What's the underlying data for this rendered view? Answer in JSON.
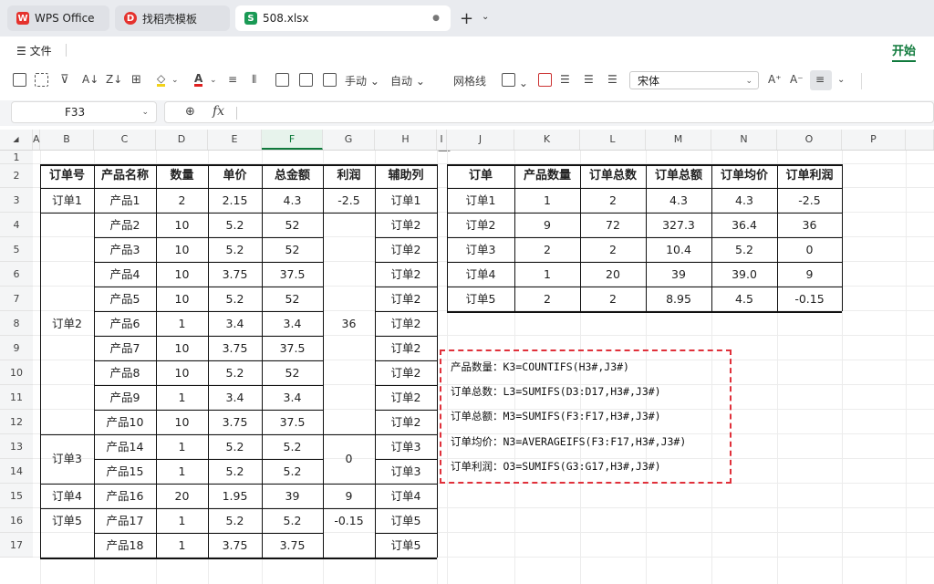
{
  "tabs": [
    {
      "label": "WPS Office",
      "icon": "wps-logo-icon"
    },
    {
      "label": "找稻壳模板",
      "icon": "docer-icon"
    },
    {
      "label": "508.xlsx",
      "icon": "spreadsheet-icon",
      "active": true
    }
  ],
  "menu": {
    "file": "文件",
    "start": "开始"
  },
  "toolbar": {
    "manual": "手动",
    "auto": "自动",
    "gridlines": "网格线",
    "font": "宋体"
  },
  "formula": {
    "cell_ref": "F33",
    "fx": "fx",
    "content": ""
  },
  "columns": [
    "A",
    "B",
    "C",
    "D",
    "E",
    "F",
    "G",
    "H",
    "I",
    "J",
    "K",
    "L",
    "M",
    "N",
    "O",
    "P"
  ],
  "rows": [
    "1",
    "2",
    "3",
    "4",
    "5",
    "6",
    "7",
    "8",
    "9",
    "10",
    "11",
    "12",
    "13",
    "14",
    "15",
    "16",
    "17"
  ],
  "left_table": {
    "headers": [
      "订单号",
      "产品名称",
      "数量",
      "单价",
      "总金额",
      "利润",
      "辅助列"
    ],
    "rows": [
      {
        "order": "订单1",
        "product": "产品1",
        "qty": "2",
        "price": "2.15",
        "total": "4.3",
        "profit": "-2.5",
        "helper": "订单1"
      },
      {
        "order": "",
        "product": "产品2",
        "qty": "10",
        "price": "5.2",
        "total": "52",
        "profit": "",
        "helper": "订单2"
      },
      {
        "order": "",
        "product": "产品3",
        "qty": "10",
        "price": "5.2",
        "total": "52",
        "profit": "",
        "helper": "订单2"
      },
      {
        "order": "",
        "product": "产品4",
        "qty": "10",
        "price": "3.75",
        "total": "37.5",
        "profit": "",
        "helper": "订单2"
      },
      {
        "order": "",
        "product": "产品5",
        "qty": "10",
        "price": "5.2",
        "total": "52",
        "profit": "",
        "helper": "订单2"
      },
      {
        "order": "订单2",
        "product": "产品6",
        "qty": "1",
        "price": "3.4",
        "total": "3.4",
        "profit": "36",
        "helper": "订单2"
      },
      {
        "order": "",
        "product": "产品7",
        "qty": "10",
        "price": "3.75",
        "total": "37.5",
        "profit": "",
        "helper": "订单2"
      },
      {
        "order": "",
        "product": "产品8",
        "qty": "10",
        "price": "5.2",
        "total": "52",
        "profit": "",
        "helper": "订单2"
      },
      {
        "order": "",
        "product": "产品9",
        "qty": "1",
        "price": "3.4",
        "total": "3.4",
        "profit": "",
        "helper": "订单2"
      },
      {
        "order": "",
        "product": "产品10",
        "qty": "10",
        "price": "3.75",
        "total": "37.5",
        "profit": "",
        "helper": "订单2"
      },
      {
        "order": "订单3",
        "product": "产品14",
        "qty": "1",
        "price": "5.2",
        "total": "5.2",
        "profit": "0",
        "helper": "订单3"
      },
      {
        "order": "",
        "product": "产品15",
        "qty": "1",
        "price": "5.2",
        "total": "5.2",
        "profit": "",
        "helper": "订单3"
      },
      {
        "order": "订单4",
        "product": "产品16",
        "qty": "20",
        "price": "1.95",
        "total": "39",
        "profit": "9",
        "helper": "订单4"
      },
      {
        "order": "订单5",
        "product": "产品17",
        "qty": "1",
        "price": "5.2",
        "total": "5.2",
        "profit": "-0.15",
        "helper": "订单5"
      },
      {
        "order": "",
        "product": "产品18",
        "qty": "1",
        "price": "3.75",
        "total": "3.75",
        "profit": "",
        "helper": "订单5"
      }
    ]
  },
  "right_table": {
    "headers": [
      "订单",
      "产品数量",
      "订单总数",
      "订单总额",
      "订单均价",
      "订单利润"
    ],
    "rows": [
      [
        "订单1",
        "1",
        "2",
        "4.3",
        "4.3",
        "-2.5"
      ],
      [
        "订单2",
        "9",
        "72",
        "327.3",
        "36.4",
        "36"
      ],
      [
        "订单3",
        "2",
        "2",
        "10.4",
        "5.2",
        "0"
      ],
      [
        "订单4",
        "1",
        "20",
        "39",
        "39.0",
        "9"
      ],
      [
        "订单5",
        "2",
        "2",
        "8.95",
        "4.5",
        "-0.15"
      ]
    ]
  },
  "notes": [
    "产品数量：K3=COUNTIFS(H3#,J3#)",
    "订单总数：L3=SUMIFS(D3:D17,H3#,J3#)",
    "订单总额：M3=SUMIFS(F3:F17,H3#,J3#)",
    "订单均价：N3=AVERAGEIFS(F3:F17,H3#,J3#)",
    "订单利润：O3=SUMIFS(G3:G17,H3#,J3#)"
  ],
  "colors": {
    "accent": "#107a3c",
    "note_border": "#e0303a",
    "wps_red": "#e5322d"
  }
}
